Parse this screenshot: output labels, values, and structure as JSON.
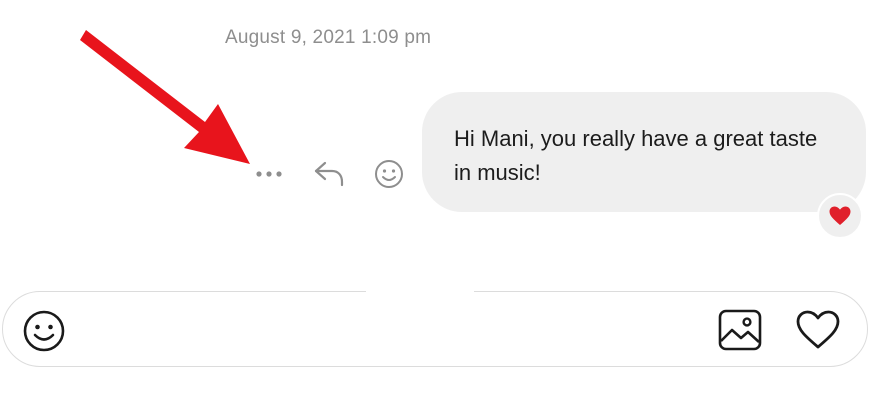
{
  "thread": {
    "timestamp": "August 9, 2021 1:09 pm"
  },
  "message": {
    "text": "Hi Mani, you really have a great taste in music!",
    "reaction": "heart",
    "actions": [
      "more",
      "reply",
      "react"
    ]
  },
  "composer": {
    "value": "",
    "placeholder": ""
  },
  "colors": {
    "bubble": "#efefef",
    "timestamp": "#8e8e8e",
    "icon": "#8e8e8e",
    "heart": "#e0202b",
    "annotation_arrow": "#e8141c"
  },
  "icons": {
    "more": "more-dots-icon",
    "reply": "reply-icon",
    "react": "emoji-icon",
    "reaction": "heart-icon",
    "composer_emoji": "emoji-icon",
    "composer_photo": "image-icon",
    "composer_like": "heart-outline-icon"
  }
}
